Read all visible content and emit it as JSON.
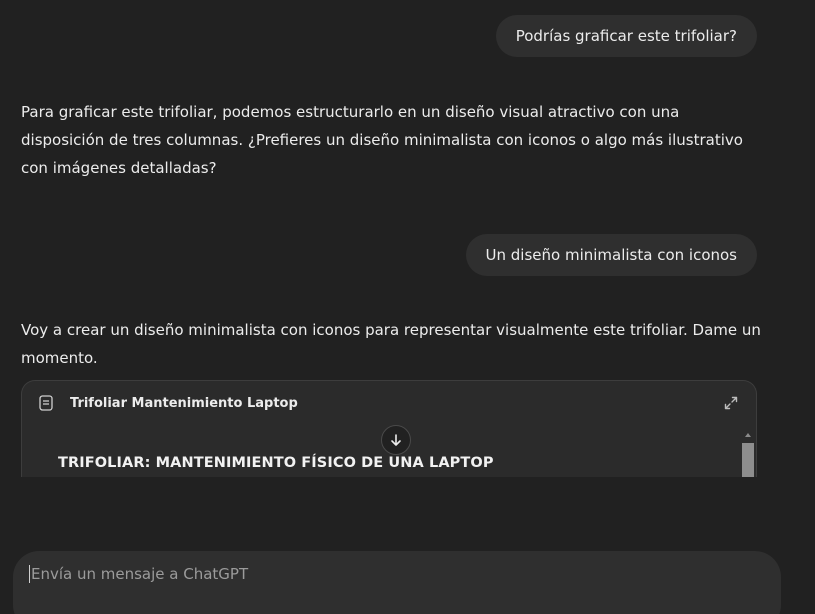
{
  "conversation": {
    "messages": [
      {
        "role": "user",
        "text": "Podrías graficar este trifoliar?"
      },
      {
        "role": "assistant",
        "text": "Para graficar este trifoliar, podemos estructurarlo en un diseño visual atractivo con una disposición de tres columnas. ¿Prefieres un diseño minimalista con iconos o algo más ilustrativo con imágenes detalladas?"
      },
      {
        "role": "user",
        "text": "Un diseño minimalista con iconos"
      },
      {
        "role": "assistant",
        "text": "Voy a crear un diseño minimalista con iconos para representar visualmente este trifoliar. Dame un momento."
      }
    ]
  },
  "canvas": {
    "title": "Trifoliar Mantenimiento Laptop",
    "heading": "TRIFOLIAR: MANTENIMIENTO FÍSICO DE UNA LAPTOP",
    "icons": {
      "doc": "document-icon",
      "expand": "expand-icon",
      "scroll": "arrow-down-icon"
    }
  },
  "composer": {
    "placeholder": "Envía un mensaje a ChatGPT",
    "value": ""
  }
}
